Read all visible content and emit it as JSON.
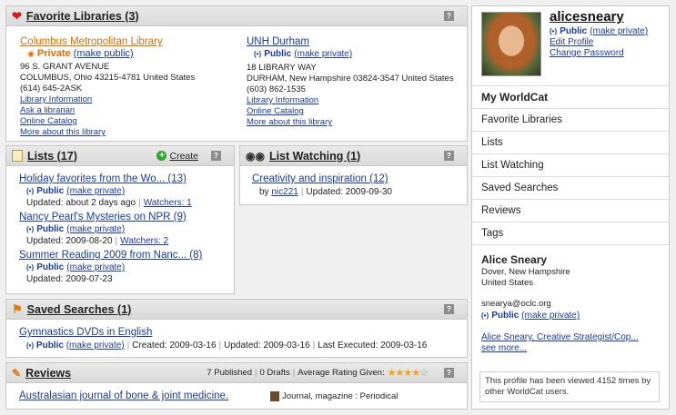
{
  "favorites": {
    "title": "Favorite Libraries (3)",
    "help": "?",
    "libraries": [
      {
        "name": "Columbus Metropolitan Library",
        "status": "Private",
        "toggle": "(make public)",
        "address1": "96 S. GRANT AVENUE",
        "address2": "COLUMBUS, Ohio 43215-4781 United States",
        "phone": "(614) 645-2ASK",
        "links": [
          "Library Information",
          "Ask a librarian",
          "Online Catalog",
          "More about this library"
        ]
      },
      {
        "name": "UNH Durham",
        "status": "Public",
        "toggle": "(make private)",
        "address1": "18 LIBRARY WAY",
        "address2": "DURHAM, New Hampshire 03824-3547 United States",
        "phone": "(603) 862-1535",
        "links": [
          "Library Information",
          "Online Catalog",
          "More about this library"
        ]
      }
    ]
  },
  "lists": {
    "title": "Lists (17)",
    "create_label": "Create",
    "help": "?",
    "items": [
      {
        "title": "Holiday favorites from the Wo... (13)",
        "status": "Public",
        "toggle": "(make private)",
        "updated": "Updated: about 2 days ago",
        "watchers": "Watchers: 1"
      },
      {
        "title": "Nancy Pearl's Mysteries on NPR (9)",
        "status": "Public",
        "toggle": "(make private)",
        "updated": "Updated: 2009-08-20",
        "watchers": "Watchers: 2"
      },
      {
        "title": "Summer Reading 2009 from Nanc... (8)",
        "status": "Public",
        "toggle": "(make private)",
        "updated": "Updated: 2009-07-23",
        "watchers": ""
      }
    ]
  },
  "watching": {
    "title": "List Watching (1)",
    "help": "?",
    "item": {
      "title": "Creativity and inspiration (12)",
      "by": "by",
      "user": "nic221",
      "updated": "Updated: 2009-09-30"
    }
  },
  "saved": {
    "title": "Saved Searches (1)",
    "help": "?",
    "item": {
      "title": "Gymnastics DVDs in English",
      "status": "Public",
      "toggle": "(make private)",
      "created": "Created: 2009-03-16",
      "updated": "Updated: 2009-03-16",
      "executed": "Last Executed: 2009-03-16"
    }
  },
  "reviews": {
    "title": "Reviews",
    "published": "7 Published",
    "drafts": "0 Drafts",
    "rating_label": "Average Rating Given:",
    "rating": 4,
    "rating_max": 5,
    "help": "?",
    "item": {
      "title": "Australasian journal of bone & joint medicine.",
      "format": "Journal, magazine : Periodical"
    }
  },
  "profile": {
    "username": "alicesneary",
    "status": "Public",
    "toggle": "(make private)",
    "edit": "Edit Profile",
    "password": "Change Password"
  },
  "nav": {
    "heading": "My WorldCat",
    "items": [
      "Favorite Libraries",
      "Lists",
      "List Watching",
      "Saved Searches",
      "Reviews",
      "Tags"
    ]
  },
  "person": {
    "name": "Alice Sneary",
    "location1": "Dover,  New Hampshire",
    "location2": "United States",
    "email": "snearya@oclc.org",
    "status": "Public",
    "toggle": "(make private)",
    "link": "Alice Sneary, Creative Strategist/Cop...",
    "more": "see more...",
    "views": "This profile has been viewed 4152 times by other WorldCat users."
  },
  "colors": {
    "accent": "#1a3a9c",
    "private": "#e46b00",
    "heart": "#d01c1c",
    "star": "#f2a20c"
  }
}
